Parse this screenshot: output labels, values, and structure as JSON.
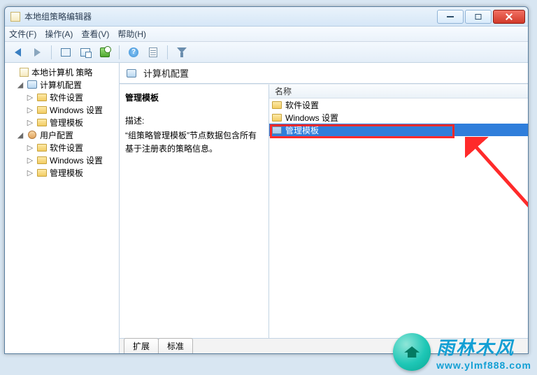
{
  "window": {
    "title": "本地组策略编辑器"
  },
  "menus": {
    "file": "文件(F)",
    "action": "操作(A)",
    "view": "查看(V)",
    "help": "帮助(H)"
  },
  "tree": {
    "root": "本地计算机 策略",
    "computer": "计算机配置",
    "user": "用户配置",
    "software": "软件设置",
    "windows": "Windows 设置",
    "admin": "管理模板"
  },
  "header": {
    "title": "计算机配置"
  },
  "desc": {
    "title": "管理模板",
    "label": "描述:",
    "body": "“组策略管理模板”节点数据包含所有基于注册表的策略信息。"
  },
  "list": {
    "column": "名称",
    "items": [
      "软件设置",
      "Windows 设置",
      "管理模板"
    ],
    "selectedIndex": 2
  },
  "tabs": {
    "extended": "扩展",
    "standard": "标准"
  },
  "watermark": {
    "line1": "雨林木风",
    "line2": "www.ylmf888.com"
  }
}
